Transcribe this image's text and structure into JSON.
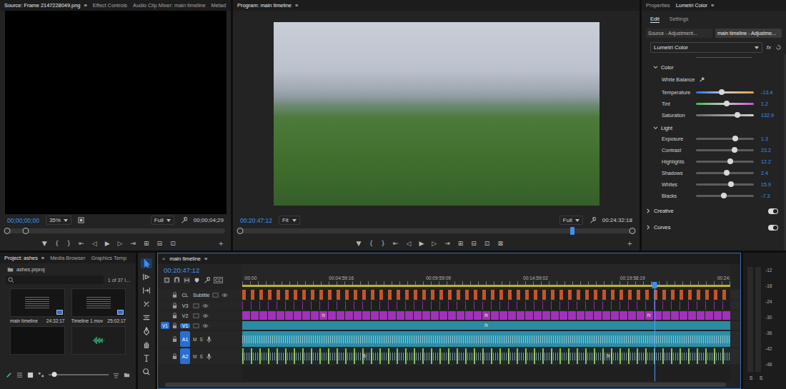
{
  "source_monitor": {
    "tabs": [
      {
        "label": "Source: Frame 2147228049.png",
        "selected": true,
        "menu": "≡"
      },
      {
        "label": "Effect Controls",
        "selected": false,
        "menu": ""
      },
      {
        "label": "Audio Clip Mixer: main timeline",
        "selected": false,
        "menu": ""
      },
      {
        "label": "Metad",
        "selected": false,
        "menu": ""
      }
    ],
    "timecode": "00;00;00;00",
    "zoom": "35%",
    "quality": "Full",
    "duration": "00;00;04;29",
    "scrub_level": 0.09,
    "transport": [
      "▼",
      "{",
      "}",
      "⇤",
      "◁",
      "▶",
      "▷",
      "⇥",
      "⊞",
      "⊟",
      "⊡"
    ],
    "add": "+"
  },
  "program_monitor": {
    "tabs": [
      {
        "label": "Program: main timeline",
        "selected": true,
        "menu": "≡"
      }
    ],
    "timecode": "00:20:47:12",
    "fit": "Fit",
    "quality": "Full",
    "duration": "00:24:32:18",
    "playhead_level": 0.845,
    "transport": [
      "▼",
      "{",
      "}",
      "⇤",
      "◁",
      "▶",
      "▷",
      "⇥",
      "⊞",
      "⊟",
      "⊡",
      "⊠"
    ],
    "add": "+"
  },
  "lumetri": {
    "tabs": [
      {
        "label": "Properties",
        "selected": false,
        "menu": ""
      },
      {
        "label": "Lumetri Color",
        "selected": true,
        "menu": "≡"
      }
    ],
    "subtabs": [
      {
        "label": "Edit",
        "selected": true
      },
      {
        "label": "Settings",
        "selected": false
      }
    ],
    "targets": [
      {
        "label": "Source - Adjustment...",
        "selected": false
      },
      {
        "label": "main timeline - Adjustme...",
        "selected": true
      }
    ],
    "effect": "Lumetri Color",
    "fx": "fx",
    "color_section": {
      "title": "Color",
      "expanded": true,
      "white_balance": "White Balance",
      "sliders": [
        {
          "label": "Temperature",
          "value": "-13.4",
          "level": 0.45,
          "kind": "temp"
        },
        {
          "label": "Tint",
          "value": "1.2",
          "level": 0.53,
          "kind": "tint"
        },
        {
          "label": "Saturation",
          "value": "132.9",
          "level": 0.72,
          "kind": "sat"
        }
      ]
    },
    "light_section": {
      "title": "Light",
      "expanded": true,
      "sliders": [
        {
          "label": "Exposure",
          "value": "1.3",
          "level": 0.68,
          "kind": "plain"
        },
        {
          "label": "Contrast",
          "value": "23.2",
          "level": 0.67,
          "kind": "plain"
        },
        {
          "label": "Highlights",
          "value": "12.2",
          "level": 0.59,
          "kind": "plain"
        },
        {
          "label": "Shadows",
          "value": "2.4",
          "level": 0.53,
          "kind": "plain"
        },
        {
          "label": "Whites",
          "value": "15.9",
          "level": 0.6,
          "kind": "plain"
        },
        {
          "label": "Blacks",
          "value": "-7.3",
          "level": 0.48,
          "kind": "plain"
        }
      ]
    },
    "collapsed_sections": [
      {
        "title": "Creative",
        "expanded": false,
        "on": true
      },
      {
        "title": "Curves",
        "expanded": false,
        "on": true
      }
    ]
  },
  "project": {
    "tabs": [
      {
        "label": "Project: ashes",
        "selected": true,
        "menu": "≡"
      },
      {
        "label": "Media Browser",
        "selected": false,
        "menu": ""
      },
      {
        "label": "Graphics Temp",
        "selected": false,
        "menu": ""
      }
    ],
    "path": "ashes.prproj",
    "count": "1 of 37 I...",
    "items": [
      {
        "name": "main timeline",
        "duration": "24:32:17",
        "kind": "sequence"
      },
      {
        "name": "Timeline 1.mov",
        "duration": "25:02:17",
        "kind": "clip"
      }
    ],
    "more": [
      {
        "kind": "black"
      },
      {
        "kind": "audio"
      }
    ],
    "thumb_zoom_level": 0.1
  },
  "tools": [
    {
      "selected": true
    },
    {
      "selected": false
    },
    {
      "selected": false
    },
    {
      "selected": false
    },
    {
      "selected": false
    },
    {
      "selected": false
    },
    {
      "selected": false
    },
    {
      "selected": false
    },
    {
      "selected": false
    }
  ],
  "timeline": {
    "tabs": [
      {
        "label": "main timeline",
        "selected": true,
        "close": "×",
        "menu": "≡"
      }
    ],
    "timecode": "00:20:47:12",
    "captions": "CC",
    "ruler": [
      ":00:00",
      "00:04:59:16",
      "00:09:59:09",
      "00:14:59:02",
      "00:19:58:19",
      "00:24:"
    ],
    "playhead_level": 0.845,
    "tracks": [
      {
        "label": "CL",
        "title": "Subtitle",
        "kind": "caption",
        "patch": "",
        "targeted": false,
        "color": "#c4552b",
        "coverage": 0.45,
        "fx": [],
        "mute": "",
        "solo": ""
      },
      {
        "label": "V3",
        "title": "",
        "kind": "video",
        "patch": "",
        "targeted": false,
        "color": "#8a2fa0",
        "coverage": 0.08,
        "fx": [],
        "mute": "",
        "solo": ""
      },
      {
        "label": "V2",
        "title": "",
        "kind": "video",
        "patch": "",
        "targeted": false,
        "color": "#a231bb",
        "coverage": 0.92,
        "fx": [
          "fx",
          "fx",
          "fx"
        ],
        "mute": "",
        "solo": ""
      },
      {
        "label": "V1",
        "title": "",
        "kind": "video",
        "patch": "V1",
        "targeted": true,
        "color": "#2a8ba3",
        "coverage": 1,
        "fx": [
          "fx"
        ],
        "mute": "",
        "solo": ""
      },
      {
        "label": "A1",
        "title": "",
        "kind": "audio",
        "patch": "",
        "targeted": true,
        "color": "#2b8fa8",
        "coverage": 1,
        "fx": [],
        "mute": "M",
        "solo": "S"
      },
      {
        "label": "A2",
        "title": "",
        "kind": "audio",
        "patch": "",
        "targeted": true,
        "color": "#86c23c",
        "coverage": 0.15,
        "fx": [
          "fx",
          "fx"
        ],
        "mute": "M",
        "solo": "S"
      }
    ]
  },
  "audio_meter": {
    "scale": [
      "-12",
      "-18",
      "-24",
      "-30",
      "-36",
      "-42",
      "-48"
    ],
    "footer": [
      "S",
      "S"
    ]
  }
}
